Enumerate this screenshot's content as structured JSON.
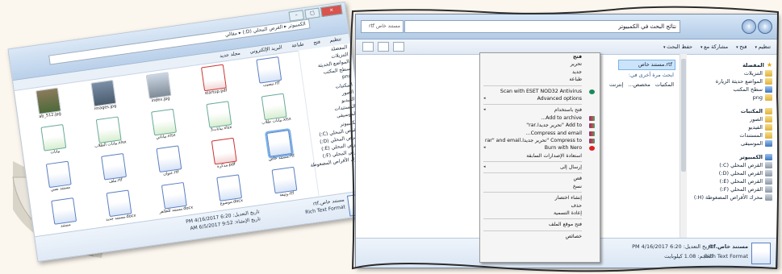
{
  "left_window": {
    "address": "الكمبيوتر ▸ القرص المحلي (D:) ▸ مقالي",
    "menus": [
      "تنظيم",
      "فتح",
      "طباعة",
      "البريد الإلكتروني",
      "مجلد جديد"
    ],
    "nav": [
      "المفضلة",
      "التنزيلات",
      "المواضع الحديثة",
      "سطح المكتب",
      "png",
      "",
      "المكتبات",
      "الصور",
      "الفيديو",
      "المستندات",
      "الموسيقى",
      "",
      "الكمبيوتر",
      "القرص المحلي (C:)",
      "القرص المحلي (D:)",
      "القرص المحلي (E:)",
      "القرص المحلي (F:)",
      "محرك الأقراص المضغوطة"
    ],
    "files": [
      {
        "label": "ab_512.jpg",
        "kind": "ph2"
      },
      {
        "label": "images.jpg",
        "kind": "ph"
      },
      {
        "label": "index.jpg",
        "kind": "ph3"
      },
      {
        "label": "startup.pdf",
        "kind": "pdf"
      },
      {
        "label": "تنصيب.rtf",
        "kind": "wd"
      },
      {
        "label": "بيانات",
        "kind": "xl"
      },
      {
        "label": "بيانات الطلاب.xlsx",
        "kind": "xl"
      },
      {
        "label": "بياناتي.xlsx",
        "kind": "xl"
      },
      {
        "label": "بيانات3.xlsx",
        "kind": "xl"
      },
      {
        "label": "بيانات طلاب.xlsx",
        "kind": "xl"
      },
      {
        "label": "مستند نصي",
        "kind": "wd"
      },
      {
        "label": "ملف.rtf",
        "kind": "wd"
      },
      {
        "label": "عنوان.rtf",
        "kind": "wd"
      },
      {
        "label": "مذكرة.pdf",
        "kind": "pdf"
      },
      {
        "label": "مستند خاص.rtf",
        "kind": "wd"
      },
      {
        "label": "مستند",
        "kind": "wd"
      },
      {
        "label": "مستند جديد.docx",
        "kind": "wd"
      },
      {
        "label": "مستند للظاهر.docx",
        "kind": "wd"
      },
      {
        "label": "موضوع.docx",
        "kind": "wd"
      },
      {
        "label": "وثيقة.rtf",
        "kind": "wd"
      }
    ],
    "details": {
      "name": "مستند خاص.rtf",
      "type": "Rich Text Format",
      "modified": "تاريخ التعديل: 6:20 PM 4/16/2017",
      "created": "تاريخ الإنشاء: 9:52 AM 6/5/2017"
    }
  },
  "right_window": {
    "address": "نتائج البحث في الكمبيوتر",
    "search_text": "rtf مستند خاص",
    "nav_buttons": [
      "‹",
      "›"
    ],
    "toolbar": [
      "تنظيم",
      "فتح",
      "مشاركة مع",
      "حفظ البحث"
    ],
    "nav_groups": [
      {
        "header": "المفضلة",
        "icon": "star",
        "items": [
          {
            "t": "التنزيلات",
            "i": "fold"
          },
          {
            "t": "المواضع حديثة الزيارة",
            "i": "fold"
          },
          {
            "t": "سطح المكتب",
            "i": "blue"
          },
          {
            "t": "png",
            "i": "fold"
          }
        ]
      },
      {
        "header": "المكتبات",
        "icon": "fold",
        "items": [
          {
            "t": "الصور",
            "i": "fold"
          },
          {
            "t": "الفيديو",
            "i": "fold"
          },
          {
            "t": "المستندات",
            "i": "fold"
          },
          {
            "t": "الموسيقى",
            "i": "blue"
          }
        ]
      },
      {
        "header": "الكمبيوتر",
        "icon": "blue",
        "items": [
          {
            "t": "القرص المحلي (C:)",
            "i": "drv"
          },
          {
            "t": "القرص المحلي (D:)",
            "i": "drv"
          },
          {
            "t": "القرص المحلي (E:)",
            "i": "drv"
          },
          {
            "t": "القرص المحلي (F:)",
            "i": "drv"
          },
          {
            "t": "محرك الأقراص المضغوطة (H:)",
            "i": "drv"
          }
        ]
      }
    ],
    "selected_file": "rtf.مستند خاص",
    "search_again_label": "ابحث مرة أخرى في:",
    "search_again_items": [
      "المكتبات",
      "مخصص...",
      "إنترنت"
    ],
    "details": {
      "name": "مستند خاص.rtf",
      "type": "Rich Text Format",
      "modified": "تاريخ التعديل: 6:20 PM 4/16/2017",
      "size": "الحجم: 1.08 كيلوبايت"
    }
  },
  "context_menu": [
    {
      "label": "فتح",
      "bold": true
    },
    {
      "label": "تحرير"
    },
    {
      "label": "جديد"
    },
    {
      "label": "طباعة"
    },
    {
      "sep": true
    },
    {
      "label": "Scan with ESET NOD32 Antivirus",
      "icon": "eset"
    },
    {
      "label": "Advanced options",
      "sub": true
    },
    {
      "sep": true
    },
    {
      "label": "فتح باستخدام",
      "sub": true
    },
    {
      "label": "Add to archive...",
      "icon": "rar"
    },
    {
      "label": "Add to \"تحرير جديدا.rar\"",
      "icon": "rar"
    },
    {
      "label": "Compress and email...",
      "icon": "rar"
    },
    {
      "label": "Compress to \"تحرير جديدا.rar\" and email",
      "icon": "rar"
    },
    {
      "label": "Burn with Nero",
      "icon": "nero",
      "sub": true
    },
    {
      "label": "استعادة الإصدارات السابقة"
    },
    {
      "sep": true
    },
    {
      "label": "إرسال إلى",
      "sub": true
    },
    {
      "sep": true
    },
    {
      "label": "قص"
    },
    {
      "label": "نسخ"
    },
    {
      "sep": true
    },
    {
      "label": "إنشاء اختصار"
    },
    {
      "label": "حذف"
    },
    {
      "label": "إعادة التسمية"
    },
    {
      "sep": true
    },
    {
      "label": "فتح موقع الملف"
    },
    {
      "sep": true
    },
    {
      "label": "خصائص"
    }
  ]
}
